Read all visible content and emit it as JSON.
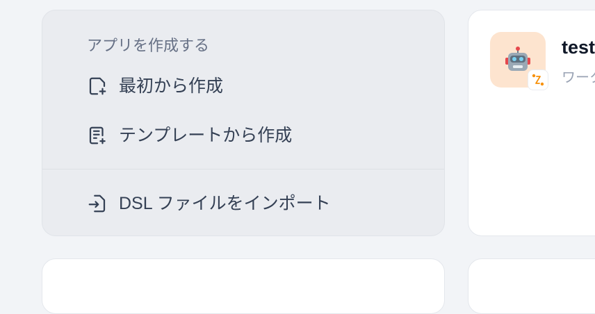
{
  "create_menu": {
    "title": "アプリを作成する",
    "items": [
      {
        "label": "最初から作成",
        "icon": "file-plus-icon"
      },
      {
        "label": "テンプレートから作成",
        "icon": "file-text-plus-icon"
      },
      {
        "label": "DSL ファイルをインポート",
        "icon": "file-import-icon"
      }
    ]
  },
  "app_card": {
    "name": "test",
    "type": "ワーク",
    "icon": "robot-icon",
    "badge_icon": "workflow-icon",
    "icon_bg": "#fde4cf"
  }
}
